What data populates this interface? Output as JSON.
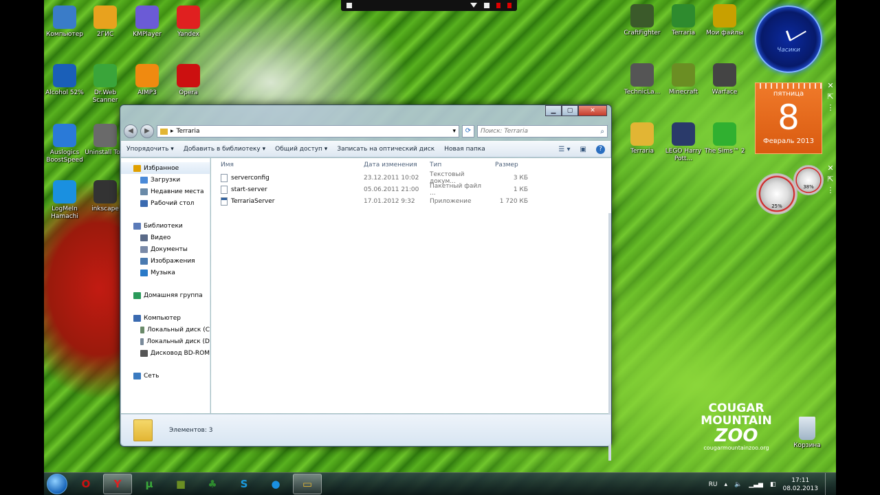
{
  "desktop": {
    "left_icons": [
      {
        "label": "Компьютер",
        "icon": "computer-icon",
        "color": "#3a7cc8"
      },
      {
        "label": "2ГИС",
        "icon": "2gis-icon",
        "color": "#e8a21e"
      },
      {
        "label": "KMPlayer",
        "icon": "kmplayer-icon",
        "color": "#6b5bd6"
      },
      {
        "label": "Yandex",
        "icon": "yandex-browser-icon",
        "color": "#e02020"
      },
      {
        "label": "Alcohol 52%",
        "icon": "alcohol-icon",
        "color": "#1a5fb8"
      },
      {
        "label": "Dr.Web Scanner",
        "icon": "drweb-icon",
        "color": "#3aa53a"
      },
      {
        "label": "AIMP3",
        "icon": "aimp-icon",
        "color": "#f08a10"
      },
      {
        "label": "Opera",
        "icon": "opera-icon",
        "color": "#cc1010"
      },
      {
        "label": "Auslogics BoostSpeed",
        "icon": "auslogics-icon",
        "color": "#2a7ad8"
      },
      {
        "label": "Uninstall Tool",
        "icon": "uninstall-tool-icon",
        "color": "#6a6a6a"
      },
      {
        "label": "LogMeIn Hamachi",
        "icon": "hamachi-icon",
        "color": "#1a90e0"
      },
      {
        "label": "inkscape",
        "icon": "inkscape-icon",
        "color": "#333333"
      }
    ],
    "right_icons": [
      {
        "label": "CraftFighter",
        "icon": "craftfighter-icon",
        "color": "#3b5a2a"
      },
      {
        "label": "Terraria",
        "icon": "terraria-tree-icon",
        "color": "#2e8b2e"
      },
      {
        "label": "Мои файлы",
        "icon": "phone-files-icon",
        "color": "#c8a000"
      },
      {
        "label": "TechnicLa...",
        "icon": "technic-launcher-icon",
        "color": "#555555"
      },
      {
        "label": "Minecraft",
        "icon": "minecraft-grass-icon",
        "color": "#6b8e23"
      },
      {
        "label": "Warface",
        "icon": "warface-icon",
        "color": "#444444"
      },
      {
        "label": "Terraria",
        "icon": "folder-icon",
        "color": "#e2b534"
      },
      {
        "label": "LEGO Harry Pott...",
        "icon": "lego-harry-potter-icon",
        "color": "#2a3a6a"
      },
      {
        "label": "The Sims™ 2",
        "icon": "sims-plumbob-icon",
        "color": "#30b030"
      }
    ],
    "recycle_bin": {
      "label": "Корзина",
      "icon": "recycle-bin-icon"
    }
  },
  "gadgets": {
    "clock_label": "Часики",
    "calendar": {
      "weekday": "пятница",
      "day": "8",
      "month": "Февраль 2013"
    },
    "cpu_meter": {
      "cpu": "25%",
      "ram": "38%"
    }
  },
  "logo": {
    "line1": "COUGAR",
    "line2": "MOUNTAIN",
    "line3": "ZOO",
    "url": "cougarmountainzoo.org"
  },
  "explorer": {
    "address": "Terraria",
    "search_placeholder": "Поиск: Terraria",
    "commands": [
      "Упорядочить ▾",
      "Добавить в библиотеку ▾",
      "Общий доступ ▾",
      "Записать на оптический диск",
      "Новая папка"
    ],
    "nav": [
      {
        "label": "Избранное",
        "icon": "star-icon",
        "level": 0,
        "color": "#e0a000"
      },
      {
        "label": "Загрузки",
        "icon": "downloads-folder-icon",
        "level": 1,
        "color": "#4a8ad8"
      },
      {
        "label": "Недавние места",
        "icon": "recent-places-icon",
        "level": 1,
        "color": "#6a8aa8"
      },
      {
        "label": "Рабочий стол",
        "icon": "desktop-icon",
        "level": 1,
        "color": "#3a6ab0"
      },
      {
        "label": "Библиотеки",
        "icon": "libraries-icon",
        "level": 0,
        "gap": true,
        "color": "#5a7ab8"
      },
      {
        "label": "Видео",
        "icon": "video-icon",
        "level": 1,
        "color": "#5a6a88"
      },
      {
        "label": "Документы",
        "icon": "documents-icon",
        "level": 1,
        "color": "#7a8aa8"
      },
      {
        "label": "Изображения",
        "icon": "pictures-icon",
        "level": 1,
        "color": "#4a7ab0"
      },
      {
        "label": "Музыка",
        "icon": "music-icon",
        "level": 1,
        "color": "#2a7ac8"
      },
      {
        "label": "Домашняя группа",
        "icon": "homegroup-icon",
        "level": 0,
        "gap": true,
        "color": "#2a9a5a"
      },
      {
        "label": "Компьютер",
        "icon": "computer-icon",
        "level": 0,
        "gap": true,
        "color": "#3a6ab0"
      },
      {
        "label": "Локальный диск (C",
        "icon": "local-disk-c-icon",
        "level": 1,
        "color": "#6a8a6a"
      },
      {
        "label": "Локальный диск (D",
        "icon": "local-disk-d-icon",
        "level": 1,
        "color": "#7a8a9a"
      },
      {
        "label": "Дисковод BD-ROM",
        "icon": "bd-rom-drive-icon",
        "level": 1,
        "color": "#555555"
      },
      {
        "label": "Сеть",
        "icon": "network-icon",
        "level": 0,
        "gap": true,
        "color": "#3a7ac0"
      }
    ],
    "columns": [
      "Имя",
      "Дата изменения",
      "Тип",
      "Размер"
    ],
    "files": [
      {
        "name": "serverconfig",
        "date": "23.12.2011 10:02",
        "type": "Текстовый докум...",
        "size": "3 КБ",
        "icon": "text-file-icon"
      },
      {
        "name": "start-server",
        "date": "05.06.2011 21:00",
        "type": "Пакетный файл ...",
        "size": "1 КБ",
        "icon": "batch-file-icon"
      },
      {
        "name": "TerrariaServer",
        "date": "17.01.2012 9:32",
        "type": "Приложение",
        "size": "1 720 КБ",
        "icon": "application-icon"
      }
    ],
    "status": "Элементов: 3"
  },
  "taskbar": {
    "items": [
      {
        "icon": "opera-icon",
        "glyph": "O",
        "color": "#cc1010"
      },
      {
        "icon": "yandex-browser-icon",
        "glyph": "Y",
        "color": "#e02020",
        "active": true
      },
      {
        "icon": "utorrent-icon",
        "glyph": "µ",
        "color": "#3aa83a"
      },
      {
        "icon": "minecraft-grass-icon",
        "glyph": "■",
        "color": "#6b8e23"
      },
      {
        "icon": "terraria-tree-icon",
        "glyph": "♣",
        "color": "#2e8b2e"
      },
      {
        "icon": "skype-icon",
        "glyph": "S",
        "color": "#1a9ae0"
      },
      {
        "icon": "hamachi-icon",
        "glyph": "●",
        "color": "#1a90e0"
      },
      {
        "icon": "explorer-folder-icon",
        "glyph": "▭",
        "color": "#e2b534",
        "active": true
      }
    ],
    "lang": "RU",
    "time": "17:11",
    "date": "08.02.2013"
  }
}
